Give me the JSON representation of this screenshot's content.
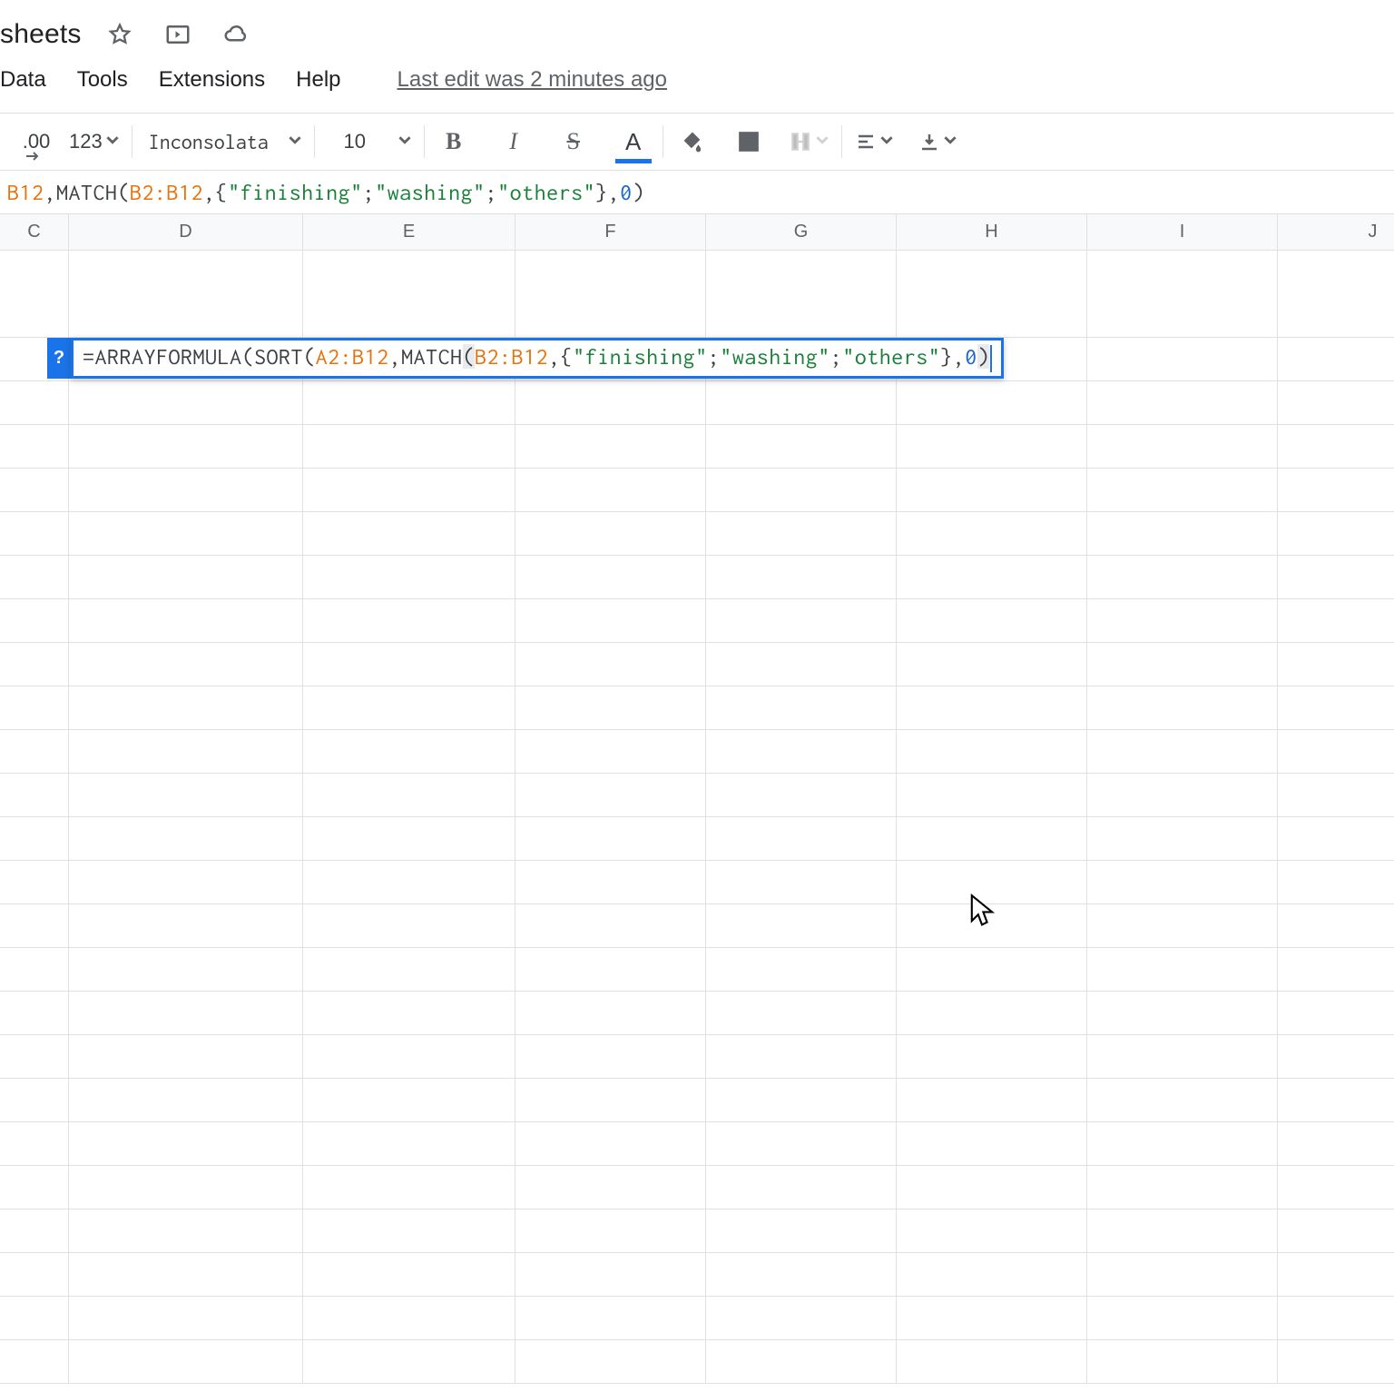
{
  "title_suffix": "sheets",
  "menus": [
    "Data",
    "Tools",
    "Extensions",
    "Help"
  ],
  "last_edit": "Last edit was 2 minutes ago",
  "toolbar": {
    "decimal_btn": ".00",
    "format_menu": "123",
    "font_name": "Inconsolata",
    "font_size": "10",
    "bold": "B",
    "italic": "I",
    "strike": "S",
    "textcolor": "A"
  },
  "formula_bar": {
    "prefix_range": "B12",
    "t1": ",MATCH(",
    "r2": "B2:B12",
    "t2": ",{",
    "s1": "\"finishing\"",
    "t3": ";",
    "s2": "\"washing\"",
    "t4": ";",
    "s3": "\"others\"",
    "t5": "},",
    "n1": "0",
    "t6": ")"
  },
  "columns": [
    "C",
    "D",
    "E",
    "F",
    "G",
    "H",
    "I",
    "J"
  ],
  "cell_editor": {
    "help": "?",
    "eq": "=",
    "fn1": "ARRAYFORMULA",
    "p1": "(",
    "fn2": "SORT",
    "p2": "(",
    "r1": "A2:B12",
    "c1": ",",
    "fn3": "MATCH",
    "p3": "(",
    "r2": "B2:B12",
    "c2": ",{",
    "s1": "\"finishing\"",
    "sc1": ";",
    "s2": "\"washing\"",
    "sc2": ";",
    "s3": "\"others\"",
    "c3": "},",
    "n1": "0",
    "p4": ")"
  }
}
